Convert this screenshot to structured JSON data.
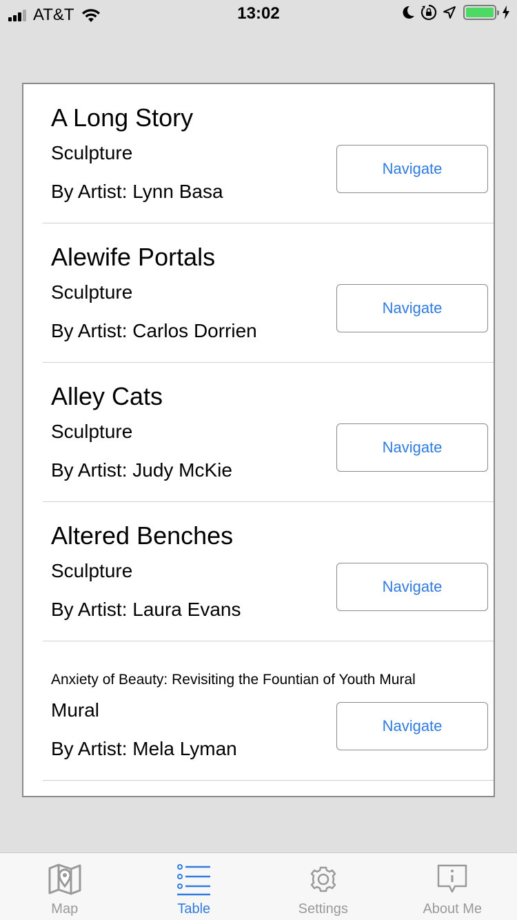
{
  "status_bar": {
    "carrier": "AT&T",
    "time": "13:02",
    "battery_level": 1.0
  },
  "items": [
    {
      "title": "A Long Story",
      "type": "Sculpture",
      "artist": "By Artist: Lynn Basa",
      "button": "Navigate"
    },
    {
      "title": "Alewife Portals",
      "type": "Sculpture",
      "artist": "By Artist: Carlos Dorrien",
      "button": "Navigate"
    },
    {
      "title": "Alley Cats",
      "type": "Sculpture",
      "artist": "By Artist: Judy McKie",
      "button": "Navigate"
    },
    {
      "title": "Altered Benches",
      "type": "Sculpture",
      "artist": "By Artist: Laura Evans",
      "button": "Navigate"
    },
    {
      "title": "Anxiety of Beauty: Revisiting the Fountian of Youth Mural",
      "type": "Mural",
      "artist": "By Artist: Mela Lyman",
      "button": "Navigate"
    }
  ],
  "tab_bar": {
    "tabs": [
      {
        "label": "Map",
        "icon": "map-icon"
      },
      {
        "label": "Table",
        "icon": "list-icon"
      },
      {
        "label": "Settings",
        "icon": "gear-icon"
      },
      {
        "label": "About Me",
        "icon": "info-bubble-icon"
      }
    ],
    "active": "Table"
  },
  "colors": {
    "accent": "#2f7be0",
    "inactive_tab": "#999999",
    "battery": "#4cd964",
    "background": "#e0e0e0"
  }
}
